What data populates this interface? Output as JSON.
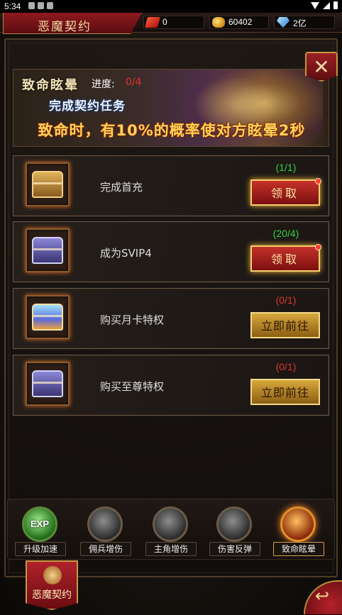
{
  "status_bar": {
    "time": "5:34"
  },
  "header": {
    "title": "恶魔契约",
    "currencies": [
      {
        "icon": "red-ticket-icon",
        "value": "0"
      },
      {
        "icon": "gold-ingot-icon",
        "value": "60402"
      },
      {
        "icon": "diamond-icon",
        "value": "2亿"
      }
    ]
  },
  "banner": {
    "title": "致命眩晕",
    "progress_label": "进度:",
    "progress_value": "0/4",
    "subtitle": "完成契约任务",
    "effect": "致命时，有10%的概率使对方眩晕2秒"
  },
  "close_label": "✕",
  "tasks": [
    {
      "name": "完成首充",
      "progress": "(1/1)",
      "button": "领取",
      "status": "done",
      "chest": "gold"
    },
    {
      "name": "成为SVIP4",
      "progress": "(20/4)",
      "button": "领取",
      "status": "done",
      "chest": "purple"
    },
    {
      "name": "购买月卡特权",
      "progress": "(0/1)",
      "button": "立即前往",
      "status": "todo",
      "chest": "crystal"
    },
    {
      "name": "购买至尊特权",
      "progress": "(0/1)",
      "button": "立即前往",
      "status": "todo",
      "chest": "purple"
    }
  ],
  "skills": [
    {
      "label": "升级加速",
      "badge": "EXP"
    },
    {
      "label": "佣兵增伤"
    },
    {
      "label": "主角增伤"
    },
    {
      "label": "伤害反弹"
    },
    {
      "label": "致命眩晕"
    }
  ],
  "bottom_tab": {
    "label": "恶魔契约"
  },
  "back_label": "↩",
  "colors": {
    "done": "#35d442",
    "todo": "#e2332d",
    "accent_red": "#8e1a1e",
    "gold_border": "#c8953e"
  }
}
